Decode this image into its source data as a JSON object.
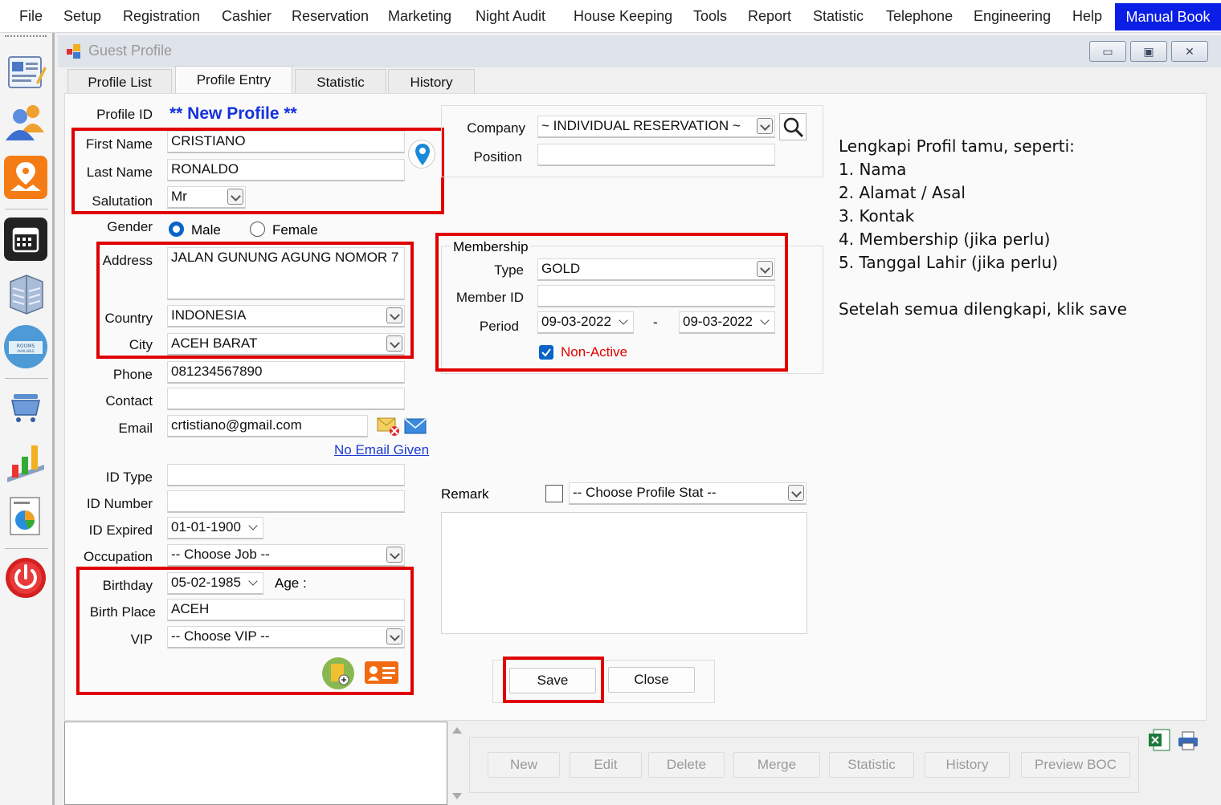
{
  "menu": {
    "items": [
      "File",
      "Setup",
      "Registration",
      "Cashier",
      "Reservation",
      "Marketing",
      "Night Audit",
      "House Keeping",
      "Tools",
      "Report",
      "Statistic",
      "Telephone",
      "Engineering",
      "Help"
    ],
    "manual_book": "Manual Book"
  },
  "window": {
    "title": "Guest Profile",
    "min": "▭",
    "max": "▣",
    "close": "✕"
  },
  "tabs": [
    "Profile List",
    "Profile Entry",
    "Statistic",
    "History"
  ],
  "form": {
    "profile_id_label": "Profile ID",
    "profile_id_value": "** New Profile **",
    "first_name_label": "First Name",
    "first_name": "CRISTIANO",
    "last_name_label": "Last Name",
    "last_name": "RONALDO",
    "salutation_label": "Salutation",
    "salutation": "Mr",
    "gender_label": "Gender",
    "gender_male": "Male",
    "gender_female": "Female",
    "address_label": "Address",
    "address": "JALAN GUNUNG AGUNG NOMOR 7",
    "country_label": "Country",
    "country": "INDONESIA",
    "city_label": "City",
    "city": "ACEH BARAT",
    "phone_label": "Phone",
    "phone": "081234567890",
    "contact_label": "Contact",
    "contact": "",
    "email_label": "Email",
    "email": "crtistiano@gmail.com",
    "no_email": "No Email Given",
    "id_type_label": "ID Type",
    "id_type": "",
    "id_number_label": "ID Number",
    "id_number": "",
    "id_expired_label": "ID Expired",
    "id_expired": "01-01-1900",
    "occupation_label": "Occupation",
    "occupation": "-- Choose Job --",
    "birthday_label": "Birthday",
    "birthday": "05-02-1985",
    "age_label": "Age :",
    "birth_place_label": "Birth Place",
    "birth_place": "ACEH",
    "vip_label": "VIP",
    "vip": "-- Choose VIP --"
  },
  "company": {
    "company_label": "Company",
    "company": "~ INDIVIDUAL RESERVATION ~",
    "position_label": "Position",
    "position": ""
  },
  "membership": {
    "legend": "Membership",
    "type_label": "Type",
    "type": "GOLD",
    "member_id_label": "Member ID",
    "member_id": "",
    "period_label": "Period",
    "period_from": "09-03-2022",
    "period_sep": "-",
    "period_to": "09-03-2022",
    "non_active": "Non-Active"
  },
  "remark": {
    "label": "Remark",
    "profile_stat": "-- Choose Profile Stat --"
  },
  "actions": {
    "save": "Save",
    "close": "Close"
  },
  "bottom_buttons": [
    "New",
    "Edit",
    "Delete",
    "Merge",
    "Statistic",
    "History",
    "Preview BOC"
  ],
  "instructions": {
    "heading": "Lengkapi Profil tamu, seperti:",
    "items": [
      "1. Nama",
      "2. Alamat / Asal",
      "3. Kontak",
      "4. Membership (jika perlu)",
      "5. Tanggal Lahir (jika perlu)"
    ],
    "footer": "Setelah semua dilengkapi, klik save"
  },
  "colors": {
    "accent_blue": "#0a1ee6",
    "highlight_red": "#e00000",
    "profile_id_blue": "#1432dc",
    "non_active_red": "#e00000"
  }
}
